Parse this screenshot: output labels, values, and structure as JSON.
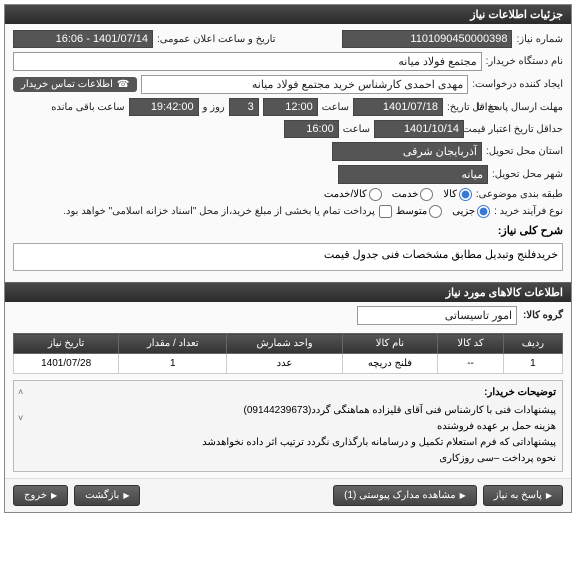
{
  "panel": {
    "title": "جزئیات اطلاعات نیاز"
  },
  "form": {
    "need_no_label": "شماره نیاز:",
    "need_no": "1101090450000398",
    "announce_label": "تاریخ و ساعت اعلان عمومی:",
    "announce_value": "1401/07/14 - 16:06",
    "buyer_org_label": "نام دستگاه خریدار:",
    "buyer_org": "مجتمع فولاد میانه",
    "requester_label": "ایجاد کننده درخواست:",
    "requester": "مهدی احمدی کارشناس خرید مجتمع فولاد میانه",
    "contact_btn": "اطلاعات تماس خریدار",
    "deadline_label": "حداقل تاریخ:",
    "deadline_until": "مهلت ارسال پاسخ: تا",
    "deadline_date": "1401/07/18",
    "hour_label": "ساعت",
    "deadline_hour": "12:00",
    "and_label": "روز و",
    "days_left": "3",
    "remain_time": "19:42:00",
    "remain_suffix": "ساعت باقی مانده",
    "price_valid_label": "حداقل تاریخ اعتبار قیمت: تا تاریخ:",
    "price_valid_date": "1401/10/14",
    "price_valid_hour": "16:00",
    "province_label": "استان محل تحویل:",
    "province": "آذربایجان شرقی",
    "city_label": "شهر محل تحویل:",
    "city": "میانه",
    "category_label": "طبقه بندی موضوعی:",
    "cat_goods": "کالا",
    "cat_service": "خدمت",
    "cat_goods_service": "کالا/خدمت",
    "process_label": "نوع فرآیند خرید :",
    "proc_partial": "جزیی",
    "proc_medium": "متوسط",
    "process_note": "پرداخت تمام یا بخشی از مبلغ خرید،از محل \"اسناد خزانه اسلامی\" خواهد بود.",
    "desc_label": "شرح کلی نیاز:",
    "desc_value": "خریدفلنج وتبدیل مطابق مشخصات فنی جدول قیمت"
  },
  "goods": {
    "header": "اطلاعات کالاهای مورد نیاز",
    "group_label": "گروه کالا:",
    "group_value": "امور تاسیساتی",
    "columns": [
      "ردیف",
      "کد کالا",
      "نام کالا",
      "واحد شمارش",
      "تعداد / مقدار",
      "تاریخ نیاز"
    ],
    "rows": [
      {
        "idx": "1",
        "code": "--",
        "name": "فلنج دریچه",
        "unit": "عدد",
        "qty": "1",
        "date": "1401/07/28"
      }
    ]
  },
  "notes": {
    "label": "توضیحات خریدار:",
    "lines": [
      "پیشنهادات فنی با کارشناس فنی آقای قلیزاده هماهنگی گردد(09144239673)",
      "هزینه حمل بر عهده فروشنده",
      "پیشنهاداتی که فرم استعلام تکمیل و درسامانه بارگذاری نگردد ترتیب اثر داده نخواهدشد",
      "نحوه پرداخت –سی روزکاری"
    ]
  },
  "footer": {
    "reply": "پاسخ به نیاز",
    "attachments": "مشاهده مدارک پیوستی (1)",
    "back": "بازگشت",
    "exit": "خروج"
  }
}
